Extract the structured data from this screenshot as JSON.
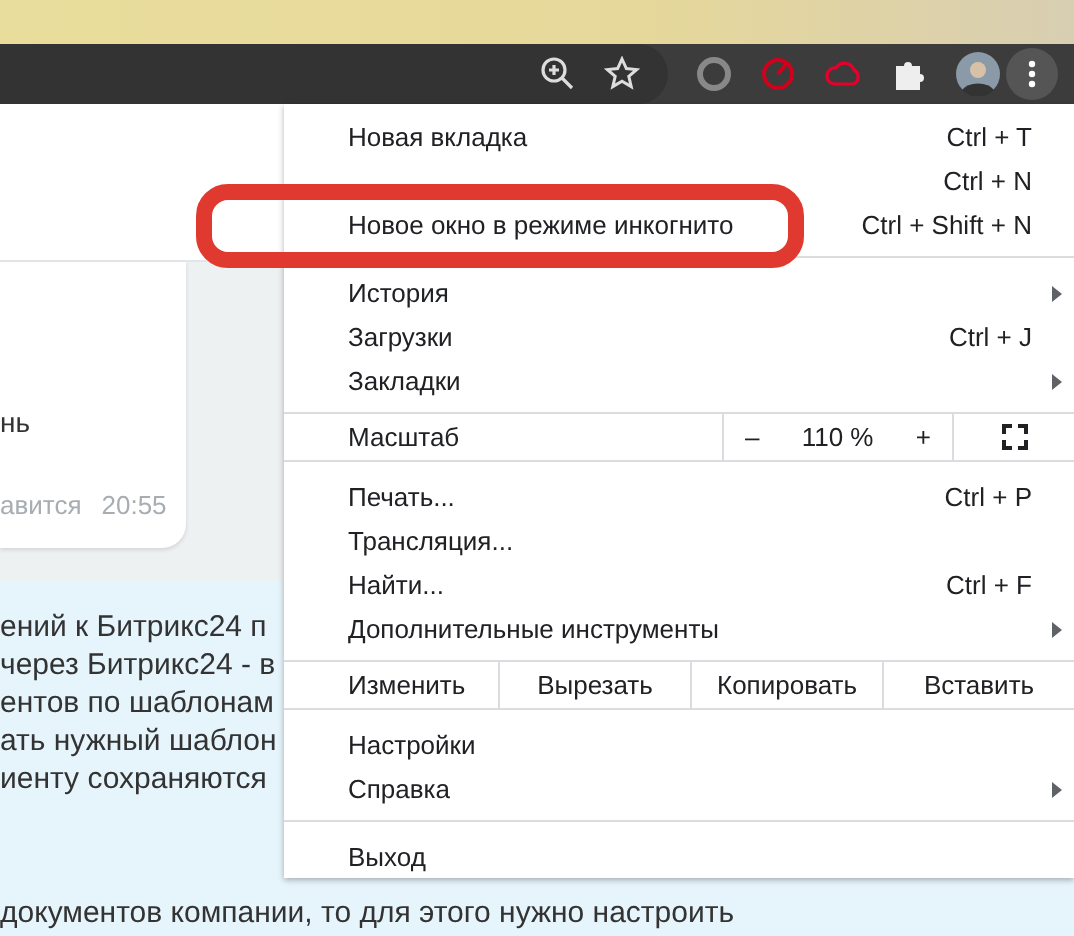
{
  "page": {
    "bubble": {
      "text": "нь",
      "status": "авится",
      "time": "20:55"
    },
    "message_lines": [
      "ений к Битрикс24 п",
      "через Битрикс24 - в",
      "ентов по шаблонам",
      "ать нужный шаблон",
      "иенту сохраняются"
    ],
    "last_line": "документов компании, то для этого нужно настроить"
  },
  "menu": {
    "items": [
      {
        "kind": "item",
        "label": "Новая вкладка",
        "shortcut": "Ctrl + T",
        "submenu": false
      },
      {
        "kind": "item",
        "shortcut": "Ctrl + N",
        "submenu": false
      },
      {
        "kind": "item",
        "label": "Новое окно в режиме инкогнито",
        "shortcut": "Ctrl + Shift + N",
        "submenu": false,
        "highlighted": true
      },
      {
        "kind": "separator"
      },
      {
        "kind": "item",
        "label": "История",
        "submenu": true
      },
      {
        "kind": "item",
        "label": "Загрузки",
        "shortcut": "Ctrl + J",
        "submenu": false
      },
      {
        "kind": "item",
        "label": "Закладки",
        "submenu": true
      },
      {
        "kind": "separator"
      },
      {
        "kind": "zoom",
        "label": "Масштаб",
        "minus": "–",
        "value": "110 %",
        "plus": "+"
      },
      {
        "kind": "separator"
      },
      {
        "kind": "item",
        "label": "Печать...",
        "shortcut": "Ctrl + P",
        "submenu": false
      },
      {
        "kind": "item",
        "label": "Трансляция...",
        "submenu": false
      },
      {
        "kind": "item",
        "label": "Найти...",
        "shortcut": "Ctrl + F",
        "submenu": false
      },
      {
        "kind": "item",
        "label": "Дополнительные инструменты",
        "submenu": true
      },
      {
        "kind": "separator"
      },
      {
        "kind": "edit",
        "label": "Изменить",
        "buttons": [
          "Вырезать",
          "Копировать",
          "Вставить"
        ]
      },
      {
        "kind": "separator"
      },
      {
        "kind": "item",
        "label": "Настройки",
        "submenu": false
      },
      {
        "kind": "item",
        "label": "Справка",
        "submenu": true
      },
      {
        "kind": "separator"
      },
      {
        "kind": "item",
        "label": "Выход",
        "submenu": false
      }
    ]
  }
}
